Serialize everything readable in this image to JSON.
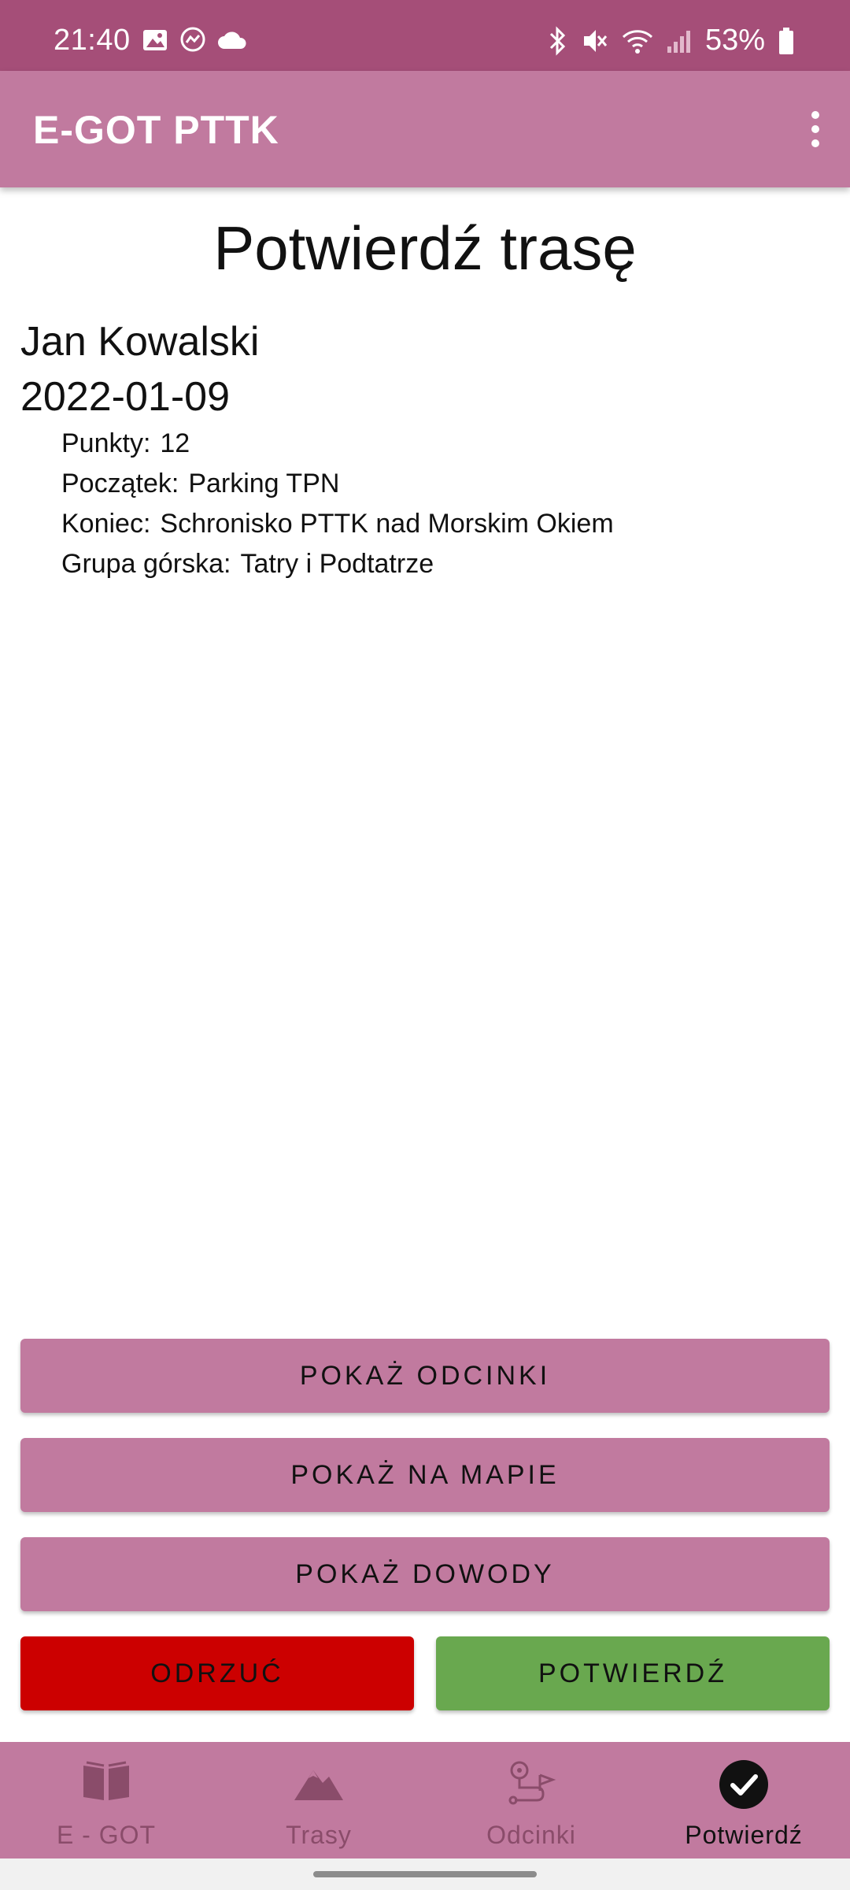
{
  "status_bar": {
    "time": "21:40",
    "battery": "53%",
    "left_icons": [
      "image-icon",
      "messenger-icon",
      "cloud-icon"
    ],
    "right_icons": [
      "bluetooth-icon",
      "mute-icon",
      "wifi-icon",
      "signal-icon",
      "battery-icon"
    ]
  },
  "app_bar": {
    "title": "E-GOT PTTK",
    "menu_icon": "more-vert-icon"
  },
  "page": {
    "title": "Potwierdź trasę",
    "person": "Jan Kowalski",
    "date": "2022-01-09",
    "details": [
      {
        "label": "Punkty:",
        "value": "12"
      },
      {
        "label": "Początek:",
        "value": "Parking TPN"
      },
      {
        "label": "Koniec:",
        "value": "Schronisko PTTK nad Morskim Okiem"
      },
      {
        "label": "Grupa górska:",
        "value": "Tatry i Podtatrze"
      }
    ]
  },
  "buttons": {
    "show_segments": "POKAŻ ODCINKI",
    "show_map": "POKAŻ NA MAPIE",
    "show_evidence": "POKAŻ DOWODY",
    "reject": "ODRZUĆ",
    "confirm": "POTWIERDŹ"
  },
  "bottom_nav": {
    "items": [
      {
        "label": "E - GOT",
        "icon": "book-icon",
        "active": false
      },
      {
        "label": "Trasy",
        "icon": "mountain-icon",
        "active": false
      },
      {
        "label": "Odcinki",
        "icon": "route-icon",
        "active": false
      },
      {
        "label": "Potwierdź",
        "icon": "check-circle-icon",
        "active": true
      }
    ]
  },
  "colors": {
    "status_bar": "#a54e78",
    "primary": "#c17a9f",
    "reject": "#cc0000",
    "confirm": "#69a84f",
    "nav_inactive": "#8a4c6a"
  }
}
